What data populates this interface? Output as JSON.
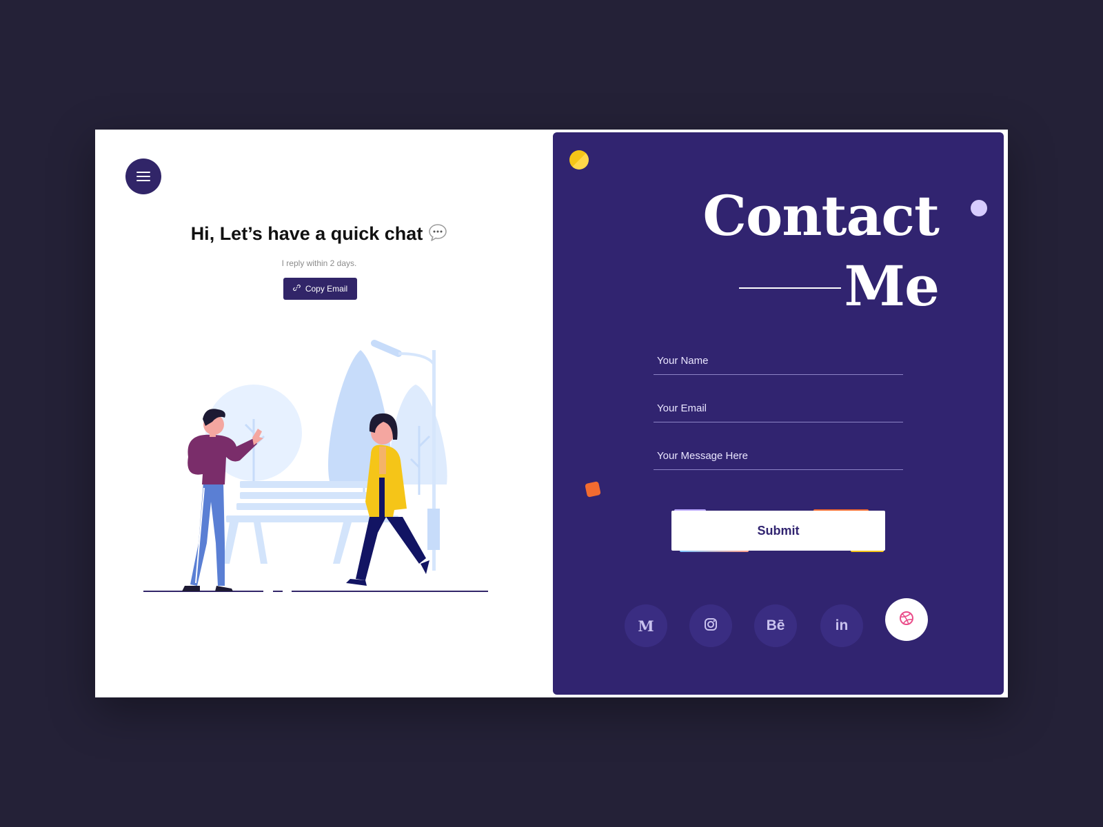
{
  "left": {
    "heading": "Hi, Let’s have a quick chat",
    "subtext": "I reply within 2 days.",
    "copy_button": "Copy Email"
  },
  "contact": {
    "title_line1": "Contact",
    "title_line2": "Me",
    "fields": {
      "name_placeholder": "Your Name",
      "email_placeholder": "Your Email",
      "message_placeholder": "Your Message Here"
    },
    "submit_label": "Submit",
    "social": [
      {
        "label": "M",
        "icon": "medium-icon"
      },
      {
        "label": "",
        "icon": "instagram-icon"
      },
      {
        "label": "Bē",
        "icon": "behance-icon"
      },
      {
        "label": "in",
        "icon": "linkedin-icon"
      },
      {
        "label": "",
        "icon": "dribbble-icon"
      }
    ]
  },
  "colors": {
    "background": "#242137",
    "brand_purple": "#312470",
    "accent_yellow": "#f5c518",
    "accent_orange": "#f26b30",
    "accent_lilac": "#d7ccff",
    "dribbble_pink": "#ea4c89"
  }
}
